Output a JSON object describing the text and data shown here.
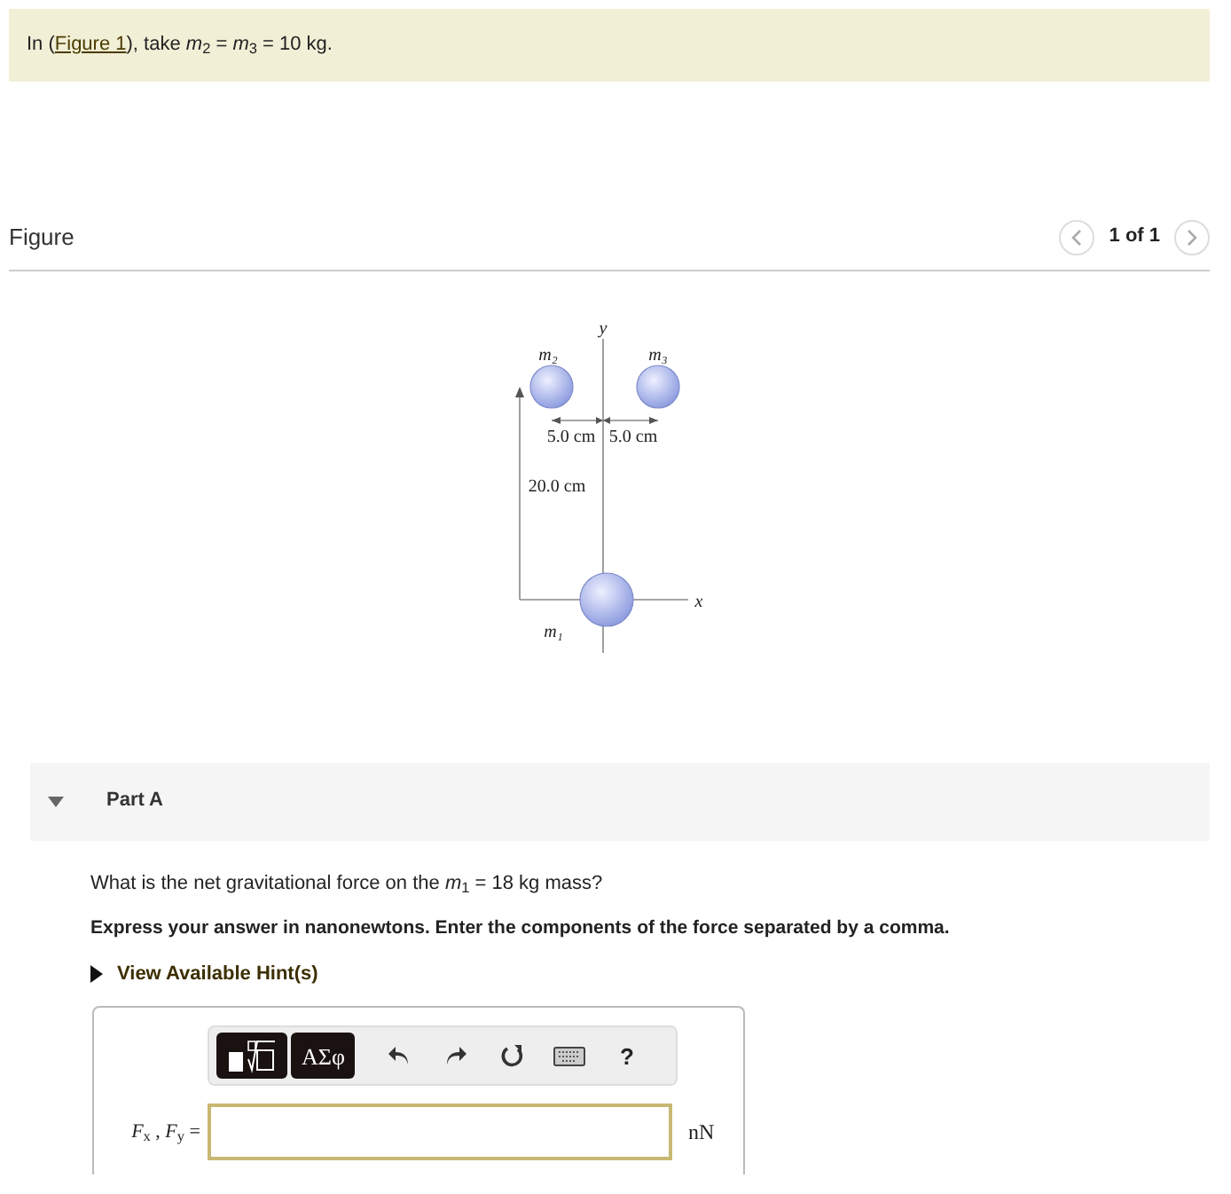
{
  "intro": {
    "before": "In (",
    "link": "Figure 1",
    "after": "), take *m*$_{2}$ = *m*$_{3}$ = 10 kg."
  },
  "figure": {
    "title": "Figure",
    "pager": "1 of 1",
    "labels": {
      "y_axis": "y",
      "x_axis": "x",
      "m2": "m₂",
      "m3": "m₃",
      "m1": "m₁",
      "left_gap": "5.0 cm",
      "right_gap": "5.0 cm",
      "height": "20.0 cm"
    }
  },
  "part": {
    "title": "Part A",
    "expanded": true,
    "question": "What is the net gravitational force on the *m*$_{1}$ = 18 kg mass?",
    "instruction": "Express your answer in nanonewtons. Enter the components of the force separated by a comma.",
    "hint": "View Available Hint(s)",
    "toolbar": [
      {
        "kind": "templates"
      },
      {
        "kind": "symbols",
        "label": "ΑΣφ"
      },
      {
        "kind": "undo"
      },
      {
        "kind": "redo"
      },
      {
        "kind": "reset"
      },
      {
        "kind": "keyboard"
      },
      {
        "kind": "help",
        "label": "?"
      }
    ],
    "answer": {
      "label": "*F*$_{x}$ , *F*$_{y}$ =",
      "unit": "nN"
    }
  }
}
